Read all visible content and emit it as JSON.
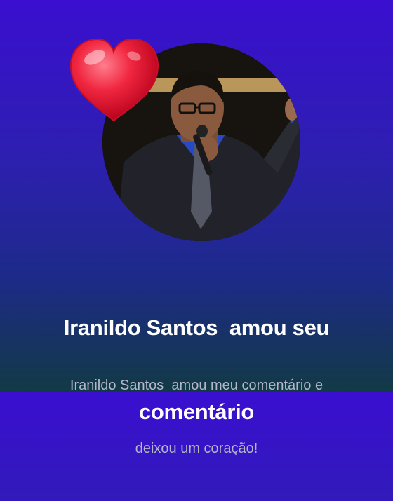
{
  "notification": {
    "title_line1": "Iranildo Santos  amou seu",
    "title_line2": "comentário",
    "subtitle_line1": "Iranildo Santos  amou meu comentário e",
    "subtitle_line2": "deixou um coração!"
  },
  "icons": {
    "reaction": "heart-icon",
    "avatar": "avatar"
  },
  "colors": {
    "background_top": "#3a0fd0",
    "background_bottom": "#123a45",
    "heart": "#e8213a",
    "title": "#ffffff",
    "subtitle": "#b4b7c8"
  }
}
